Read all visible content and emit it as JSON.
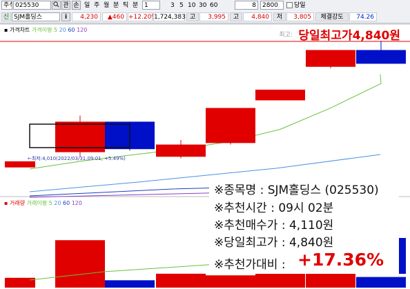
{
  "toolbar": {
    "market": "주식",
    "code": "025530",
    "search_icon": "search-icon",
    "btn_gwan": "관",
    "btn_lock": "손",
    "periods": [
      "일",
      "주",
      "월",
      "분",
      "틱",
      "분"
    ],
    "period_value": "1",
    "minute_options": [
      "3",
      "5",
      "10",
      "30",
      "60"
    ],
    "interval_value": "8",
    "count_value": "2800",
    "chk_label": "당일"
  },
  "quote": {
    "name_tag": "신",
    "name": "SJM홀딩스",
    "info_icon": "i",
    "price": "4,230",
    "change": "▲460",
    "change_pct": "+12.20%",
    "volume": "1,724,383",
    "high_label": "고",
    "high": "3,995",
    "open_label": "고",
    "open": "4,840",
    "low_label": "저",
    "low": "3,805",
    "strength_label": "체결강도",
    "strength": "74.26"
  },
  "price_legend": {
    "chart_label": "가격차트",
    "ma_label": "가격이평",
    "ma_periods": [
      "5",
      "20",
      "60",
      "120"
    ]
  },
  "volume_legend": {
    "chart_label": "거래량",
    "ma_label": "거래이평",
    "ma_periods": [
      "5",
      "20",
      "60",
      "120"
    ]
  },
  "annotations": {
    "high_small": "최고:",
    "high_big": "당일최고가4,840원",
    "low_note": "←최저:4,010(2022/03/31,09:01, +5.49%)"
  },
  "info": {
    "line1": "※종목명 : SJM홀딩스 (025530)",
    "line2": "※추천시간 : 09시 02분",
    "line3": "※추천매수가 : 4,110원",
    "line4": "※당일최고가 : 4,840원",
    "line5_label": "※추천가대비 :",
    "line5_value": "+17.36%"
  },
  "colors": {
    "up": "#e00000",
    "down": "#0010c8",
    "ma5": "#6abf3c",
    "ma20": "#4a90e2",
    "ma60": "#1a3fbf",
    "ma120": "#8a3cc8"
  },
  "chart_data": {
    "type": "candlestick",
    "candles": [
      {
        "open": 4010,
        "close": 4050,
        "high": 4050,
        "low": 4010,
        "dir": "up"
      },
      {
        "open": 4110,
        "close": 4310,
        "high": 4350,
        "low": 4080,
        "dir": "up"
      },
      {
        "open": 4310,
        "close": 4130,
        "high": 4310,
        "low": 4120,
        "dir": "down"
      },
      {
        "open": 4080,
        "close": 4160,
        "high": 4190,
        "low": 4070,
        "dir": "up"
      },
      {
        "open": 4170,
        "close": 4400,
        "high": 4400,
        "low": 4160,
        "dir": "up"
      },
      {
        "open": 4450,
        "close": 4520,
        "high": 4520,
        "low": 4450,
        "dir": "up"
      },
      {
        "open": 4670,
        "close": 4780,
        "high": 4780,
        "low": 4660,
        "dir": "up"
      },
      {
        "open": 4780,
        "close": 4690,
        "high": 4840,
        "low": 4690,
        "dir": "down"
      }
    ],
    "volumes": [
      120,
      580,
      90,
      170,
      150,
      180,
      260,
      130
    ],
    "price_range": [
      3950,
      4900
    ],
    "ma5": [
      4000,
      4050,
      4090,
      4130,
      4180,
      4260,
      4400,
      4560
    ]
  }
}
